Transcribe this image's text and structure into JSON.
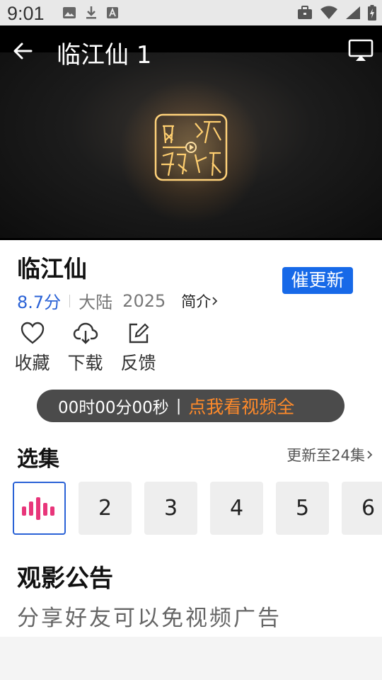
{
  "status": {
    "time": "9:01"
  },
  "player": {
    "title": "临江仙 1"
  },
  "show": {
    "title": "临江仙",
    "score": "8.7分",
    "region": "大陆",
    "year": "2025",
    "intro_label": "简介",
    "urge_label": "催更新"
  },
  "actions": [
    {
      "label": "收藏",
      "icon": "heart-icon"
    },
    {
      "label": "下载",
      "icon": "cloud-download-icon"
    },
    {
      "label": "反馈",
      "icon": "edit-icon"
    }
  ],
  "promo": {
    "time": "00时00分00秒",
    "separator": "|",
    "cta": "点我看视频全"
  },
  "episodes": {
    "title": "选集",
    "more_label": "更新至24集",
    "items": [
      "2",
      "3",
      "4",
      "5",
      "6"
    ],
    "playing_color": "#e8357a"
  },
  "notice": {
    "title": "观影公告",
    "text": "分享好友可以免视频广告"
  },
  "colors": {
    "accent": "#1769e8",
    "score": "#2a62d6",
    "cta": "#ff8a2a"
  }
}
